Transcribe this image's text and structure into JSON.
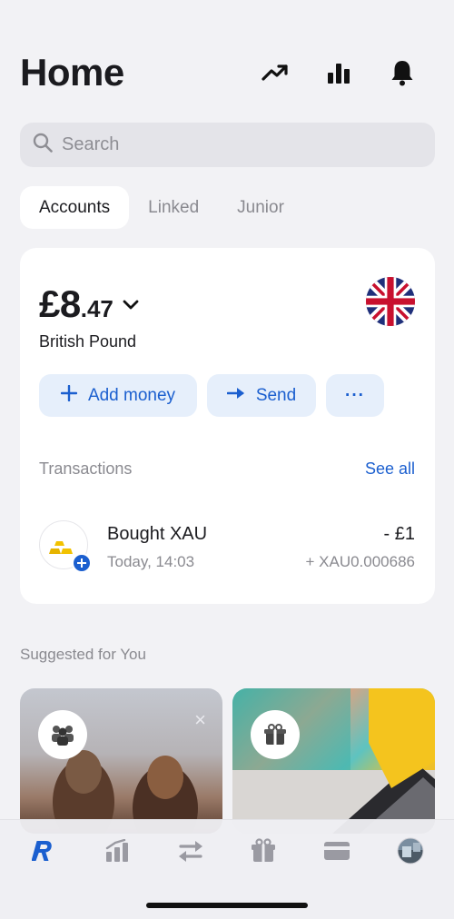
{
  "header": {
    "title": "Home",
    "icons": [
      "trend-up-icon",
      "bar-chart-icon",
      "bell-icon"
    ]
  },
  "search": {
    "placeholder": "Search",
    "value": ""
  },
  "tabs": [
    {
      "label": "Accounts",
      "active": true
    },
    {
      "label": "Linked",
      "active": false
    },
    {
      "label": "Junior",
      "active": false
    }
  ],
  "account": {
    "balance_main": "£8",
    "balance_decimal": ".47",
    "currency_name": "British Pound",
    "flag_icon": "uk-flag-icon",
    "actions": {
      "add_money": "Add money",
      "send": "Send",
      "more": "···"
    },
    "transactions": {
      "title": "Transactions",
      "see_all": "See all",
      "items": [
        {
          "name": "Bought XAU",
          "time": "Today, 14:03",
          "amount": "- £1",
          "sub_amount": "+ XAU0.000686",
          "icon": "gold-bars-icon"
        }
      ]
    }
  },
  "suggested": {
    "title": "Suggested for You",
    "close": "×"
  },
  "tabbar": {
    "items": [
      "revolut-home-icon",
      "analytics-icon",
      "transfer-icon",
      "gift-icon",
      "card-icon",
      "profile-avatar"
    ]
  },
  "colors": {
    "accent": "#1b5fcf",
    "background": "#f2f2f5",
    "card": "#ffffff",
    "action_bg": "#e6effb"
  }
}
